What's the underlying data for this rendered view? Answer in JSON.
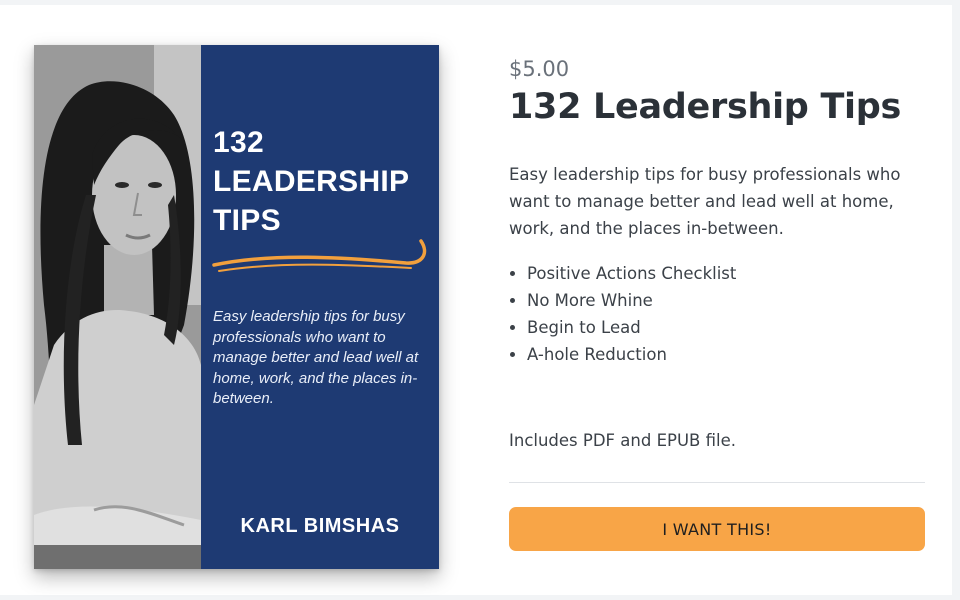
{
  "product": {
    "price": "$5.00",
    "title": "132 Leadership Tips",
    "description": "Easy leadership tips for busy professionals who want to manage better and lead well at home, work, and the places in-between.",
    "features": [
      "Positive Actions Checklist",
      "No More Whine",
      "Begin to Lead",
      "A-hole Reduction"
    ],
    "includes": "Includes PDF and EPUB file.",
    "cta_label": "I WANT THIS!"
  },
  "cover": {
    "title_lines": [
      "132",
      "LEADERSHIP",
      "TIPS"
    ],
    "blurb": "Easy leadership tips for busy professionals who want to manage better and lead well at home, work, and the places in-between.",
    "author": "KARL BIMSHAS"
  },
  "colors": {
    "cover_panel": "#1e3a73",
    "swoosh": "#f2a03d",
    "cta_background": "#f8a547",
    "title_text": "#2b3138"
  }
}
